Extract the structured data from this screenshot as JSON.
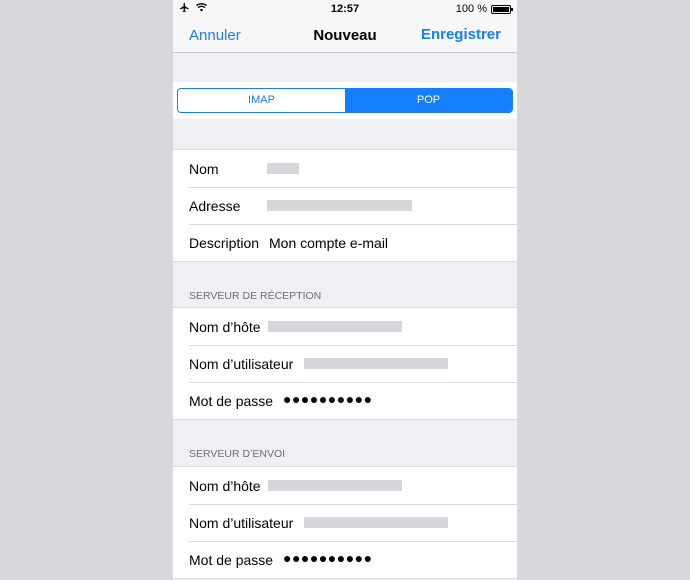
{
  "status_bar": {
    "time": "12:57",
    "battery_text": "100 %",
    "battery_level": 1.0
  },
  "nav": {
    "cancel": "Annuler",
    "title": "Nouveau",
    "save": "Enregistrer"
  },
  "segmented": {
    "options": [
      "IMAP",
      "POP"
    ],
    "selected": "POP"
  },
  "account": {
    "name_label": "Nom",
    "address_label": "Adresse",
    "description_label": "Description",
    "description_value": "Mon compte e-mail"
  },
  "incoming": {
    "header": "SERVEUR DE RÉCEPTION",
    "host_label": "Nom d’hôte",
    "user_label": "Nom d’utilisateur",
    "password_label": "Mot de passe",
    "password_mask": "●●●●●●●●●●"
  },
  "outgoing": {
    "header": "SERVEUR D’ENVOI",
    "host_label": "Nom d’hôte",
    "user_label": "Nom d’utilisateur",
    "password_label": "Mot de passe",
    "password_mask": "●●●●●●●●●●"
  },
  "colors": {
    "accent": "#147efb",
    "background": "#efeff4",
    "redaction": "#d6d5da"
  }
}
